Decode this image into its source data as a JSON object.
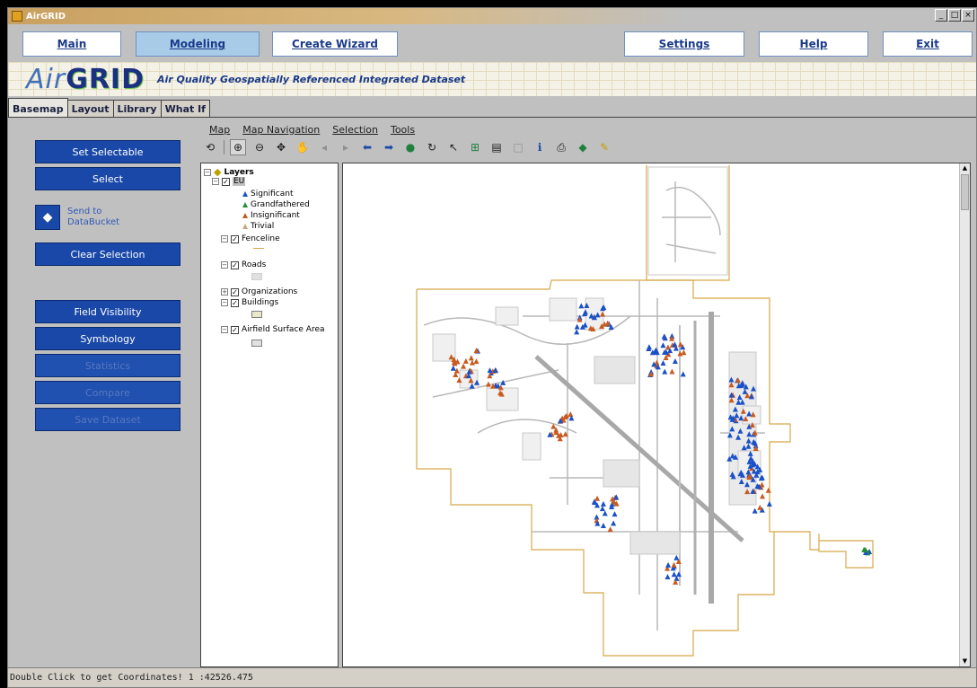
{
  "window": {
    "title": "AirGRID"
  },
  "nav": {
    "main": "Main",
    "modeling": "Modeling",
    "create_wizard": "Create Wizard",
    "settings": "Settings",
    "help": "Help",
    "exit": "Exit",
    "active": "Modeling"
  },
  "banner": {
    "logo_air": "Air",
    "logo_grid": "GRID",
    "tagline": "Air Quality Geospatially Referenced Integrated Dataset"
  },
  "tabs": [
    "Basemap",
    "Layout",
    "Library",
    "What If"
  ],
  "active_tab": "Basemap",
  "left_buttons": {
    "set_selectable": "Set Selectable",
    "select": "Select",
    "send_to": "Send to DataBucket",
    "clear_selection": "Clear Selection",
    "field_visibility": "Field Visibility",
    "symbology": "Symbology",
    "statistics": "Statistics",
    "compare": "Compare",
    "save_dataset": "Save Dataset"
  },
  "menu": [
    "Map",
    "Map Navigation",
    "Selection",
    "Tools"
  ],
  "toolbar_icons": [
    "refresh-icon",
    "zoom-in-icon",
    "zoom-out-icon",
    "full-extent-icon",
    "pan-icon",
    "back-icon",
    "forward-icon",
    "prev-extent-icon",
    "next-extent-icon",
    "globe-icon",
    "redraw-icon",
    "select-pointer-icon",
    "select-box-icon",
    "table-icon",
    "clear-icon",
    "info-icon",
    "print-icon",
    "export-icon",
    "highlight-icon"
  ],
  "layers": {
    "root": "Layers",
    "eu": "EU",
    "eu_items": [
      {
        "label": "Significant",
        "color": "#1a50c8"
      },
      {
        "label": "Grandfathered",
        "color": "#209030"
      },
      {
        "label": "Insignificant",
        "color": "#c85a20"
      },
      {
        "label": "Trivial",
        "color": "#c8a880"
      }
    ],
    "fenceline": "Fenceline",
    "roads": "Roads",
    "organizations": "Organizations",
    "buildings": "Buildings",
    "airfield": "Airfield Surface Area"
  },
  "colors": {
    "nav_text": "#1a3a8a",
    "button_blue": "#1a48a8",
    "fence": "#d8a848",
    "roads": "#b8b8b8",
    "airfield": "#d0d0d0"
  },
  "status": {
    "text": "Double Click to get Coordinates!",
    "scale": "1 :42526.475"
  }
}
